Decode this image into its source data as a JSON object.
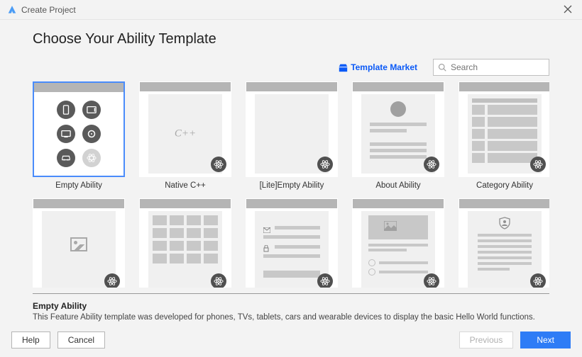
{
  "window": {
    "title": "Create Project"
  },
  "page": {
    "heading": "Choose Your Ability Template",
    "market_link": "Template Market",
    "search_placeholder": "Search"
  },
  "templates": [
    {
      "label": "Empty Ability",
      "selected": true
    },
    {
      "label": "Native C++"
    },
    {
      "label": "[Lite]Empty Ability"
    },
    {
      "label": "About Ability"
    },
    {
      "label": "Category Ability"
    },
    {
      "label": ""
    },
    {
      "label": ""
    },
    {
      "label": ""
    },
    {
      "label": ""
    },
    {
      "label": ""
    }
  ],
  "selected": {
    "title": "Empty Ability",
    "description": "This Feature Ability template was developed for phones, TVs, tablets, cars and wearable devices to display the basic Hello World functions."
  },
  "buttons": {
    "help": "Help",
    "cancel": "Cancel",
    "previous": "Previous",
    "next": "Next"
  }
}
